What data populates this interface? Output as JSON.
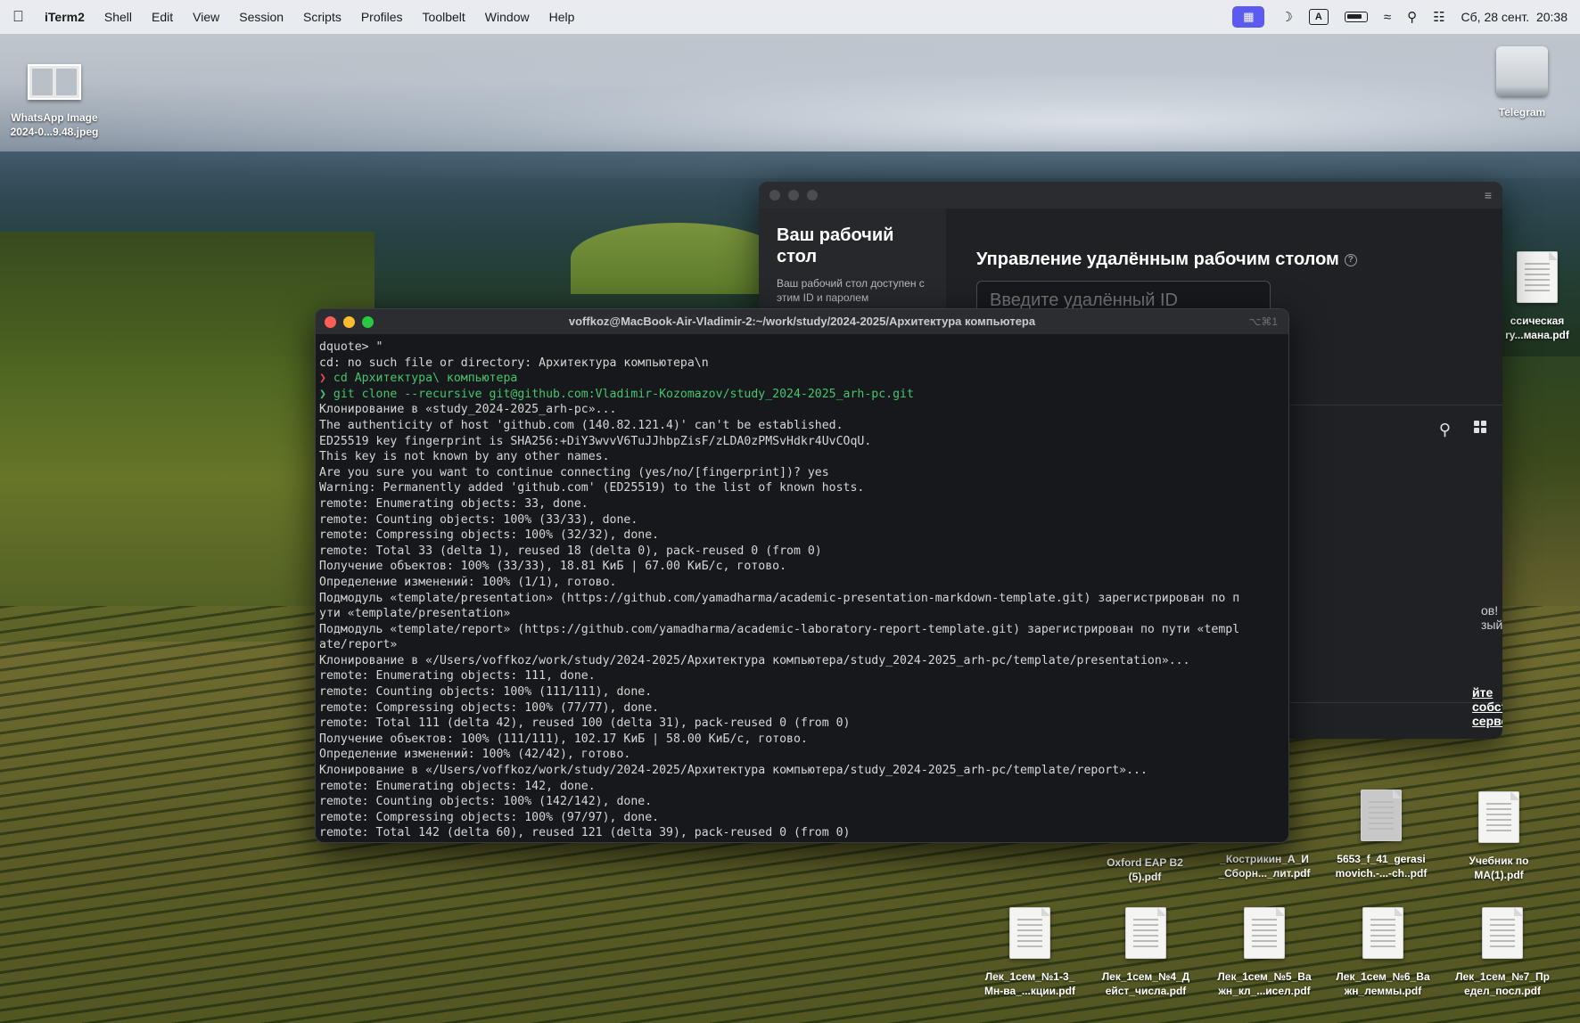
{
  "menubar": {
    "app": "iTerm2",
    "items": [
      "Shell",
      "Edit",
      "View",
      "Session",
      "Scripts",
      "Profiles",
      "Toolbelt",
      "Window",
      "Help"
    ],
    "clock": "Сб, 28 сент.  20:38",
    "keyboard_layout": "A"
  },
  "desktop": {
    "top_left_file": "WhatsApp Image 2024-0...9.48.jpeg",
    "top_right_drive": "Telegram",
    "right_file": "ссическая ry...мана.pdf",
    "row1": [
      "Oxford EAP B2 (5).pdf",
      "_Кострикин_А_И _Сборн..._лит.pdf",
      "5653_f_41_gerasi movich.-...-ch..pdf",
      "Учебник по МА(1).pdf"
    ],
    "row2": [
      "Лек_1сем_№1-3_ Мн-ва_...кции.pdf",
      "Лек_1сем_№4_Д ейст_числа.pdf",
      "Лек_1сем_№5_Ва жн_кл_...исел.pdf",
      "Лек_1сем_№6_Ва жн_леммы.pdf",
      "Лек_1сем_№7_Пр едел_посл.pdf"
    ]
  },
  "remote_app": {
    "sidebar_title": "Ваш рабочий стол",
    "sidebar_desc": "Ваш рабочий стол доступен с этим ID и паролем",
    "heading": "Управление удалённым рабочим столом",
    "input_placeholder": "Введите удалённый ID",
    "snippet_1": "ов!",
    "snippet_2": "зый.",
    "footer_link": "йте собственный сервер."
  },
  "terminal": {
    "title": "voffkoz@MacBook-Air-Vladimir-2:~/work/study/2024-2025/Архитектура компьютера",
    "shortcut": "⌥⌘1",
    "lines": [
      "dquote> \"",
      "cd: no such file or directory: Архитектура компьютера\\n",
      "cd Архитектура\\ компьютера",
      "git clone --recursive git@github.com:Vladimir-Kozomazov/study_2024-2025_arh-pc.git",
      "Клонирование в «study_2024-2025_arh-pc»...",
      "The authenticity of host 'github.com (140.82.121.4)' can't be established.",
      "ED25519 key fingerprint is SHA256:+DiY3wvvV6TuJJhbpZisF/zLDA0zPMSvHdkr4UvCOqU.",
      "This key is not known by any other names.",
      "Are you sure you want to continue connecting (yes/no/[fingerprint])? yes",
      "Warning: Permanently added 'github.com' (ED25519) to the list of known hosts.",
      "remote: Enumerating objects: 33, done.",
      "remote: Counting objects: 100% (33/33), done.",
      "remote: Compressing objects: 100% (32/32), done.",
      "remote: Total 33 (delta 1), reused 18 (delta 0), pack-reused 0 (from 0)",
      "Получение объектов: 100% (33/33), 18.81 КиБ | 67.00 КиБ/с, готово.",
      "Определение изменений: 100% (1/1), готово.",
      "Подмодуль «template/presentation» (https://github.com/yamadharma/academic-presentation-markdown-template.git) зарегистрирован по п",
      "ути «template/presentation»",
      "Подмодуль «template/report» (https://github.com/yamadharma/academic-laboratory-report-template.git) зарегистрирован по пути «templ",
      "ate/report»",
      "Клонирование в «/Users/voffkoz/work/study/2024-2025/Архитектура компьютера/study_2024-2025_arh-pc/template/presentation»...",
      "remote: Enumerating objects: 111, done.",
      "remote: Counting objects: 100% (111/111), done.",
      "remote: Compressing objects: 100% (77/77), done.",
      "remote: Total 111 (delta 42), reused 100 (delta 31), pack-reused 0 (from 0)",
      "Получение объектов: 100% (111/111), 102.17 КиБ | 58.00 КиБ/с, готово.",
      "Определение изменений: 100% (42/42), готово.",
      "Клонирование в «/Users/voffkoz/work/study/2024-2025/Архитектура компьютера/study_2024-2025_arh-pc/template/report»...",
      "remote: Enumerating objects: 142, done.",
      "remote: Counting objects: 100% (142/142), done.",
      "remote: Compressing objects: 100% (97/97), done.",
      "remote: Total 142 (delta 60), reused 121 (delta 39), pack-reused 0 (from 0)"
    ]
  }
}
